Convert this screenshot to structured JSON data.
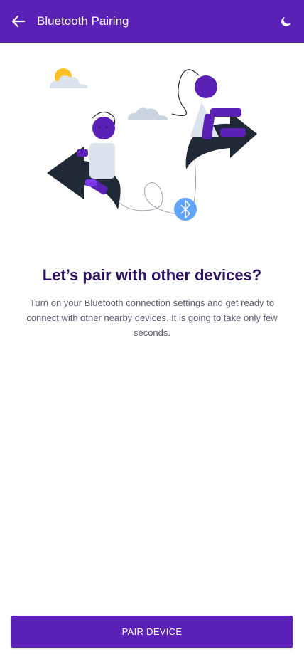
{
  "app_bar": {
    "title": "Bluetooth Pairing",
    "back_icon": "arrow-left-icon",
    "theme_icon": "moon-icon",
    "background_color": "#5b21b6"
  },
  "main": {
    "headline": "Let’s pair with other devices?",
    "description": "Turn on your Bluetooth connection settings and get ready to connect with other nearby devices. It is going to take only few seconds.",
    "illustration_icon": "bluetooth-icon"
  },
  "footer": {
    "button_label": "PAIR DEVICE"
  },
  "colors": {
    "accent": "#5b21b6",
    "dark": "#1f2937",
    "bluetooth": "#60a5fa",
    "sun": "#fbbf24",
    "cloud": "#cbd5e1"
  }
}
